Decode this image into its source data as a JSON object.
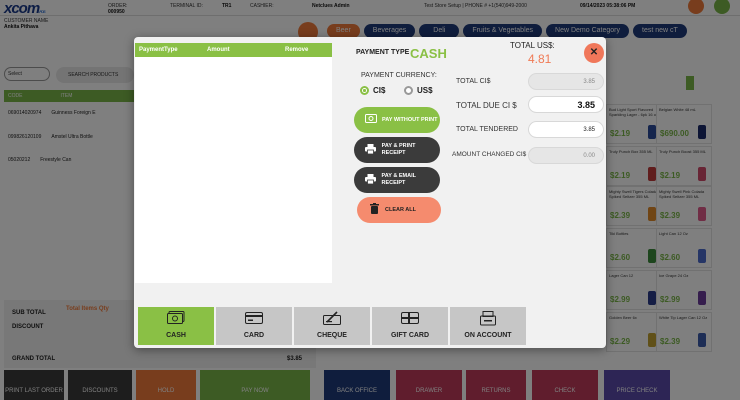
{
  "background": {
    "logo": "xcom",
    "logo_sub": "POS",
    "topbar": {
      "order_label": "ORDER:",
      "order_value": "000950",
      "terminal_label": "TERMINAL ID:",
      "terminal_value": "TR1",
      "cashier_label": "CASHIER:",
      "cashier_value": "Netclues Admin",
      "store_info": "Test Store Setup | PHONE # +1(540)949-2000",
      "datetime": "09/14/2023 05:38:06 PM"
    },
    "customer": {
      "label": "CUSTOMER NAME",
      "value": "Ankita Pithava"
    },
    "categories": [
      "Beer",
      "Beverages",
      "Deli",
      "Fruits & Vegetables",
      "New Demo Category",
      "test new cT"
    ],
    "select_placeholder": "Select",
    "search_label": "SEARCH PRODUCTS",
    "table_headers": [
      "CODE",
      "ITEM"
    ],
    "rows": [
      {
        "code": "069014020974",
        "item": "Guinness Foreign E"
      },
      {
        "code": "099826120109",
        "item": "Amstel Ultra Bottle"
      },
      {
        "code": "05020212",
        "item": "Freestyle Can"
      }
    ],
    "totals": {
      "sub_total": "SUB TOTAL",
      "discount": "DISCOUNT",
      "total_items_qty": "Total Items Qty",
      "grand_total": "GRAND TOTAL",
      "grand_total_value": "$3.85"
    },
    "bottom_buttons": [
      "PRINT LAST ORDER",
      "DISCOUNTS",
      "HOLD",
      "PAY NOW",
      "BACK OFFICE",
      "DRAWER",
      "RETURNS",
      "CHECK",
      "PRICE CHECK"
    ],
    "tiles": [
      {
        "name": "Bud Light Sport Flavored Sparkling Lager - 6pk 16 oz",
        "price": "$2.19"
      },
      {
        "name": "Belgian White 48 mL",
        "price": "$690.00"
      },
      {
        "name": "Truly Punch Box 355 ML",
        "price": "$2.19"
      },
      {
        "name": "Truly Punch Boost 355 ML",
        "price": "$2.19"
      },
      {
        "name": "Mighty Swell Tigers Colada Spiked Seltzer 355 ML",
        "price": "$2.39"
      },
      {
        "name": "Mighty Swell Pink Colada Spiked Seltzer 355 ML",
        "price": "$2.39"
      },
      {
        "name": "Tiki Bottles",
        "price": "$2.60"
      },
      {
        "name": "Light Can 12 Oz",
        "price": "$2.60"
      },
      {
        "name": "Lager Can 12",
        "price": "$2.99"
      },
      {
        "name": "Ice Grape 24 Oz",
        "price": "$2.99"
      },
      {
        "name": "Golden Beer 6x",
        "price": "$2.29"
      },
      {
        "name": "White Tip Lager Can 12 Oz",
        "price": "$2.39"
      }
    ]
  },
  "modal": {
    "table_headers": {
      "type": "PaymentType",
      "amount": "Amount",
      "remove": "Remove"
    },
    "payment_type_label": "PAYMENT TYPE",
    "payment_type_value": "CASH",
    "total_label": "TOTAL US$:",
    "total_value": "4.81",
    "close_symbol": "✕",
    "currency_label": "PAYMENT CURRENCY:",
    "currencies": [
      {
        "label": "CI$",
        "selected": true
      },
      {
        "label": "US$",
        "selected": false
      }
    ],
    "actions": [
      {
        "label": "PAY WITHOUT PRINT",
        "icon": "cash-icon"
      },
      {
        "label": "PAY & PRINT RECEIPT",
        "icon": "printer-icon"
      },
      {
        "label": "PAY & EMAIL RECEIPT",
        "icon": "printer-icon"
      },
      {
        "label": "CLEAR ALL",
        "icon": "trash-icon"
      }
    ],
    "fields": [
      {
        "label": "TOTAL CI$",
        "value": "3.85"
      },
      {
        "label": "TOTAL DUE CI $",
        "value": "3.85"
      },
      {
        "label": "TOTAL TENDERED",
        "value": "3.85"
      },
      {
        "label": "AMOUNT CHANGED CI$",
        "value": "0.00"
      }
    ],
    "methods": [
      {
        "label": "CASH",
        "icon": "cash-icon",
        "active": true
      },
      {
        "label": "CARD",
        "icon": "card-icon",
        "active": false
      },
      {
        "label": "CHEQUE",
        "icon": "cheque-icon",
        "active": false
      },
      {
        "label": "GIFT CARD",
        "icon": "gift-card-icon",
        "active": false
      },
      {
        "label": "ON ACCOUNT",
        "icon": "account-icon",
        "active": false
      }
    ],
    "colors": {
      "accent_green": "#8ac045",
      "coral": "#f58b6e",
      "dark": "#3b3b3b"
    }
  }
}
